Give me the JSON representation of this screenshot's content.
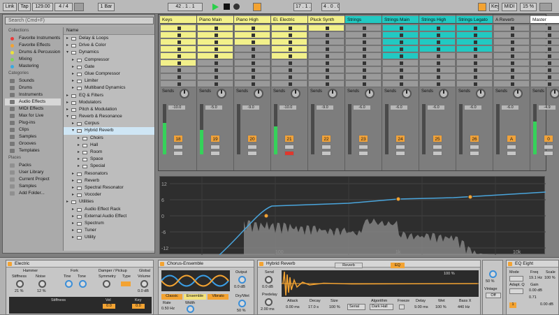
{
  "transport": {
    "link": "Link",
    "tap": "Tap",
    "tempo": "129.00",
    "signature": "4 / 4",
    "quant": "1 Bar",
    "position": "42 . 1 . 1",
    "loop_start": "17 . 1 . 1",
    "loop_len": "4 . 0 . 0",
    "key": "Key",
    "midi": "MIDI",
    "cpu": "15 %"
  },
  "browser": {
    "search_placeholder": "Search (Cmd+F)",
    "collections_label": "Collections",
    "collections": [
      {
        "label": "Favorite Instruments",
        "color": "#e93b3b"
      },
      {
        "label": "Favorite Effects",
        "color": "#f3a332"
      },
      {
        "label": "Drums & Percussion",
        "color": "#ebe23b"
      },
      {
        "label": "Mixing",
        "color": "#7ed35a"
      },
      {
        "label": "Mastering",
        "color": "#3aa9e0"
      }
    ],
    "categories_label": "Categories",
    "categories": [
      {
        "label": "Sounds",
        "selected": false
      },
      {
        "label": "Drums",
        "selected": false
      },
      {
        "label": "Instruments",
        "selected": false
      },
      {
        "label": "Audio Effects",
        "selected": true
      },
      {
        "label": "MIDI Effects",
        "selected": false
      },
      {
        "label": "Max for Live",
        "selected": false
      },
      {
        "label": "Plug-ins",
        "selected": false
      },
      {
        "label": "Clips",
        "selected": false
      },
      {
        "label": "Samples",
        "selected": false
      },
      {
        "label": "Grooves",
        "selected": false
      },
      {
        "label": "Templates",
        "selected": false
      }
    ],
    "places_label": "Places",
    "places": [
      "Packs",
      "User Library",
      "Current Project",
      "Samples",
      "Add Folder..."
    ],
    "tree_header": "Name",
    "tree": [
      {
        "label": "Delay & Loops",
        "level": 0,
        "open": false,
        "selected": false
      },
      {
        "label": "Drive & Color",
        "level": 0,
        "open": false,
        "selected": false
      },
      {
        "label": "Dynamics",
        "level": 0,
        "open": true,
        "selected": false
      },
      {
        "label": "Compressor",
        "level": 1,
        "open": false,
        "selected": false
      },
      {
        "label": "Gate",
        "level": 1,
        "open": false,
        "selected": false
      },
      {
        "label": "Glue Compressor",
        "level": 1,
        "open": false,
        "selected": false
      },
      {
        "label": "Limiter",
        "level": 1,
        "open": false,
        "selected": false
      },
      {
        "label": "Multiband Dynamics",
        "level": 1,
        "open": false,
        "selected": false
      },
      {
        "label": "EQ & Filters",
        "level": 0,
        "open": false,
        "selected": false
      },
      {
        "label": "Modulators",
        "level": 0,
        "open": false,
        "selected": false
      },
      {
        "label": "Pitch & Modulation",
        "level": 0,
        "open": false,
        "selected": false
      },
      {
        "label": "Reverb & Resonance",
        "level": 0,
        "open": true,
        "selected": false
      },
      {
        "label": "Corpus",
        "level": 1,
        "open": false,
        "selected": false
      },
      {
        "label": "Hybrid Reverb",
        "level": 1,
        "open": true,
        "selected": true
      },
      {
        "label": "Choirs",
        "level": 2,
        "open": false,
        "selected": false
      },
      {
        "label": "Hall",
        "level": 2,
        "open": false,
        "selected": false
      },
      {
        "label": "Room",
        "level": 2,
        "open": false,
        "selected": false
      },
      {
        "label": "Space",
        "level": 2,
        "open": false,
        "selected": false
      },
      {
        "label": "Special",
        "level": 2,
        "open": false,
        "selected": false
      },
      {
        "label": "Resonators",
        "level": 1,
        "open": false,
        "selected": false
      },
      {
        "label": "Reverb",
        "level": 1,
        "open": false,
        "selected": false
      },
      {
        "label": "Spectral Resonator",
        "level": 1,
        "open": false,
        "selected": false
      },
      {
        "label": "Vocoder",
        "level": 1,
        "open": false,
        "selected": false
      },
      {
        "label": "Utilities",
        "level": 0,
        "open": false,
        "selected": false
      },
      {
        "label": "Audio Effect Rack",
        "level": 1,
        "open": false,
        "selected": false
      },
      {
        "label": "External Audio Effect",
        "level": 1,
        "open": false,
        "selected": false
      },
      {
        "label": "Spectrum",
        "level": 1,
        "open": false,
        "selected": false
      },
      {
        "label": "Tuner",
        "level": 1,
        "open": false,
        "selected": false
      },
      {
        "label": "Utility",
        "level": 1,
        "open": false,
        "selected": false
      }
    ]
  },
  "session": {
    "sends_label": "Sends",
    "tracks": [
      {
        "name": "Keys",
        "color": "#f2f08a",
        "clip_rows": [
          0,
          1,
          2,
          3,
          4,
          5
        ],
        "level": 0.62,
        "db": "-10.0",
        "num": "18"
      },
      {
        "name": "Piano Main",
        "color": "#f2f08a",
        "clip_rows": [
          0,
          1,
          2,
          3,
          4
        ],
        "level": 0.48,
        "db": "-5.0",
        "num": "19"
      },
      {
        "name": "Piano High",
        "color": "#f2f08a",
        "clip_rows": [
          0,
          1,
          2
        ],
        "level": 0.0,
        "db": "-9.0",
        "num": "20"
      },
      {
        "name": "El. Electric",
        "color": "#f2f08a",
        "clip_rows": [
          0,
          1,
          2,
          3,
          4
        ],
        "level": 0.55,
        "db": "-10.0",
        "num": "21"
      },
      {
        "name": "Pluck Synth",
        "color": "#f2f08a",
        "clip_rows": [
          0
        ],
        "level": 0.0,
        "db": "-9.0",
        "num": "22"
      },
      {
        "name": "Strings",
        "color": "#22c9c2",
        "clip_rows": [],
        "level": 0.0,
        "db": "-6.0",
        "num": "23"
      },
      {
        "name": "Strings Main",
        "color": "#22c9c2",
        "clip_rows": [
          0,
          1,
          2,
          3,
          4
        ],
        "level": 0.0,
        "db": "-6.0",
        "num": "24"
      },
      {
        "name": "Strings High",
        "color": "#22c9c2",
        "clip_rows": [
          0,
          1,
          2,
          3
        ],
        "level": 0.0,
        "db": "-6.0",
        "num": "25"
      },
      {
        "name": "Strings Legato",
        "color": "#22c9c2",
        "clip_rows": [
          0,
          1,
          2,
          3
        ],
        "level": 0.0,
        "db": "-6.0",
        "num": "26"
      },
      {
        "name": "A Reverb",
        "color": "#9d9d9d",
        "clip_rows": [],
        "level": 0.0,
        "db": "-6.0",
        "num": "A"
      },
      {
        "name": "Master",
        "color": "#ffffff",
        "clip_rows": [],
        "level": 0.65,
        "db": "-4.9",
        "num": "0"
      }
    ]
  },
  "eq": {
    "db_labels": [
      "12",
      "6",
      "0",
      "-6",
      "-12"
    ],
    "freq_labels": [
      "100",
      "1k",
      "10k"
    ]
  },
  "devices": {
    "electric": {
      "title": "Electric",
      "hammer": "Hammer",
      "stiffness": "Stiffness",
      "noise": "Noise",
      "stiff_val": "21 %",
      "noise_val": "12 %",
      "fork": "Fork",
      "tine": "Tine",
      "tone": "Tone",
      "damper": "Damper / Pickup",
      "symmetry": "Symmetry",
      "type": "Type",
      "global": "Global",
      "volume": "Volume",
      "vol_val": "0.0 dB",
      "sub_labels": [
        "Stiffness",
        "Vel",
        "Key"
      ],
      "sub_vals": [
        "0.0",
        "0.0"
      ]
    },
    "chorus": {
      "title": "Chorus-Ensemble",
      "modes": [
        "Classic",
        "Ensemble",
        "Vibrato"
      ],
      "rate": "Rate",
      "rate_val": "0.50 Hz",
      "width": "Width",
      "width_val": "100 %",
      "output": "Output",
      "output_val": "0.0 dB",
      "drywet": "Dry/Wet",
      "drywet_val": "50 %"
    },
    "reverb": {
      "title": "Hybrid Reverb",
      "send": "Send",
      "send_val": "0.0 dB",
      "predelay": "Predelay",
      "predelay_val": "2.00 ms",
      "tab_reverb": "Reverb",
      "tab_eq": "EQ",
      "percent": "100 %",
      "attack": "Attack",
      "decay": "Decay",
      "size": "Size",
      "attack_val": "0.00 ms",
      "decay_val": "17.0 s",
      "size_val": "100 %",
      "mode": "Serial",
      "algorithm": "Algorithm",
      "algo_val": "Dark Hall",
      "freeze": "Freeze",
      "delay": "Delay",
      "delay_val": "9.00 ms",
      "wet": "Wet",
      "wet_val": "100 %",
      "bass": "Bass X",
      "bass_val": "440 Hz",
      "vintage": "Vintage",
      "vintage_val": "Off",
      "drywet_val": "50 %"
    },
    "eqeight": {
      "title": "EQ Eight",
      "mode": "Mode",
      "adapt": "Adapt. Q",
      "gain": "Gain",
      "freq": "Freq",
      "scale": "Scale",
      "freq_val": "19.1 Hz",
      "gain_val": "0.00 dB",
      "q_val": "0.71",
      "scale_val": "100 %",
      "band": "1",
      "out_val": "0.00 dB"
    }
  }
}
